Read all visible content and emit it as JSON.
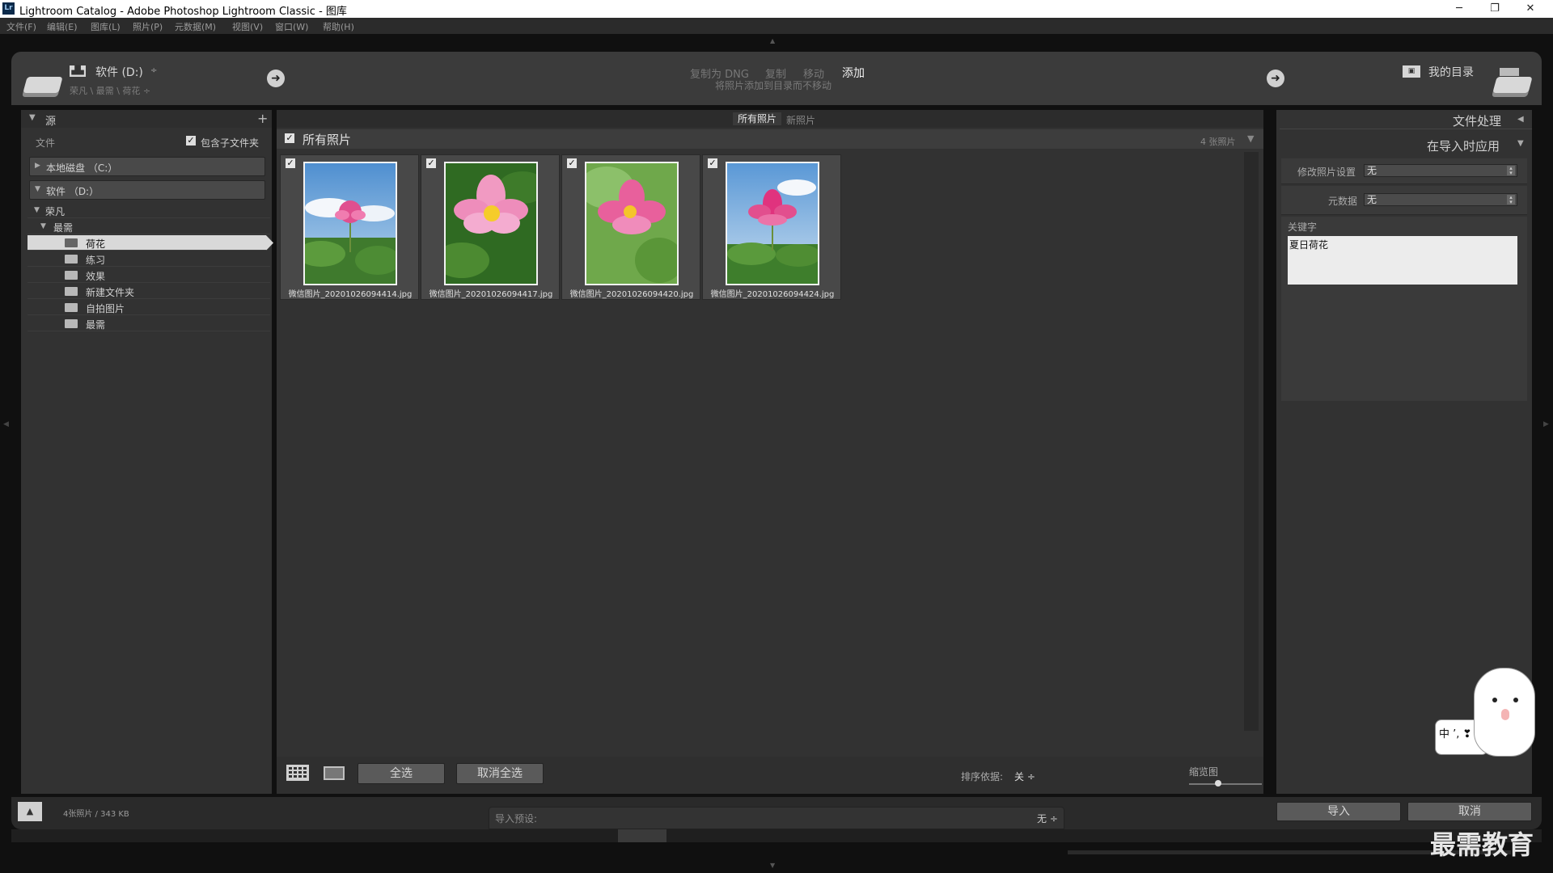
{
  "window": {
    "title": "Lightroom Catalog - Adobe Photoshop Lightroom Classic - 图库",
    "app_badge": "Lr",
    "minimize": "─",
    "restore": "❐",
    "close": "✕"
  },
  "menu": [
    "文件(F)",
    "编辑(E)",
    "图库(L)",
    "照片(P)",
    "元数据(M)",
    "视图(V)",
    "窗口(W)",
    "帮助(H)"
  ],
  "source_header": {
    "drive_name": "软件 (D:)",
    "path": "荣凡 \\ 最需 \\ 荷花 ÷"
  },
  "import_modes": {
    "items": [
      "复制为 DNG",
      "复制",
      "移动",
      "添加"
    ],
    "active": "添加",
    "description": "将照片添加到目录而不移动"
  },
  "destination": {
    "label": "我的目录"
  },
  "left_panel": {
    "title": "源",
    "add": "+",
    "files_label": "文件",
    "include_subfolders": "包含子文件夹",
    "drives": [
      "本地磁盘 （C:）",
      "软件 （D:）"
    ],
    "tree": {
      "root": "荣凡",
      "child": "最需",
      "folders": [
        "荷花",
        "练习",
        "效果",
        "新建文件夹",
        "自拍图片",
        "最需"
      ],
      "selected": "荷花"
    }
  },
  "center": {
    "tabs": [
      "所有照片",
      "新照片"
    ],
    "active_tab": "所有照片",
    "grid_title": "所有照片",
    "photo_count": "4 张照片",
    "photos": [
      {
        "filename": "微信图片_20201026094414.jpg",
        "checked": true
      },
      {
        "filename": "微信图片_20201026094417.jpg",
        "checked": true
      },
      {
        "filename": "微信图片_20201026094420.jpg",
        "checked": true
      },
      {
        "filename": "微信图片_20201026094424.jpg",
        "checked": true
      }
    ],
    "toolbar": {
      "select_all": "全选",
      "deselect_all": "取消全选",
      "sort_label": "排序依据:",
      "sort_value": "关 ÷",
      "thumb_label": "缩览图"
    }
  },
  "right_panel": {
    "file_handling": "文件处理",
    "apply_during_import": "在导入时应用",
    "develop_label": "修改照片设置",
    "develop_value": "无",
    "metadata_label": "元数据",
    "metadata_value": "无",
    "keywords_label": "关键字",
    "keywords_value": "夏日荷花"
  },
  "footer": {
    "summary": "4张照片 / 343 KB",
    "preset_label": "导入预设:",
    "preset_value": "无 ÷",
    "import_button": "导入",
    "cancel_button": "取消"
  },
  "overlay": {
    "ime_text": "中 ’, ❣",
    "watermark": "最需教育"
  },
  "colors": {
    "panel_bg": "#323232",
    "topbar_bg": "#3b3b3b",
    "selected_folder_bg": "#d9d9d9",
    "lotus_pink": "#e0508f",
    "sky": "#6aa4d8",
    "leaf": "#3d7a2c"
  }
}
